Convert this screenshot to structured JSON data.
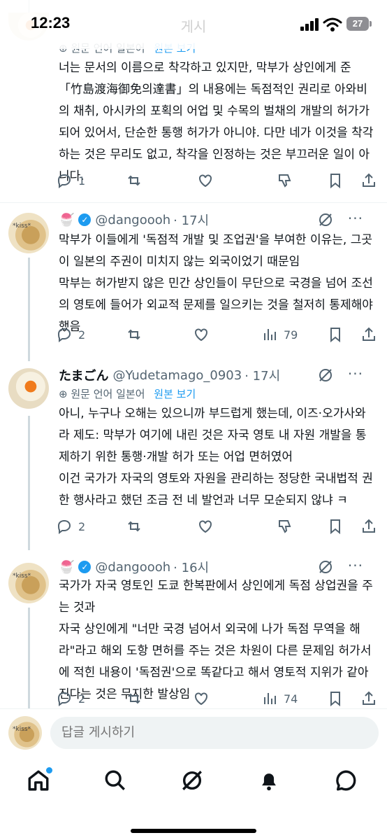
{
  "status_bar": {
    "time": "12:23",
    "title": "게시",
    "battery": "27"
  },
  "tweets": [
    {
      "translate_label": "원문 언어 일본어",
      "translate_link": "원본 보기",
      "body": "너는 문서의 이름으로 착각하고 있지만, 막부가 상인에게 준「竹島渡海御免의達書」의 내용에는 독점적인 권리로 아와비의 채취, 아시카의 포획의 어업 및 수목의 벌채의 개발의 허가가 되어 있어서, 단순한 통행 허가가 아니야. 다만 네가 이것을 착각하는 것은 무리도 없고, 착각을 인정하는 것은 부끄러운 일이 아니다.",
      "replies": "1"
    },
    {
      "emoji": "🍧",
      "handle": "@dangoooh",
      "time": "· 17시",
      "body": "막부가 이들에게 '독점적 개발 및 조업권'을 부여한 이유는, 그곳이 일본의 주권이 미치지 않는 외국이었기 때문임\n막부는 허가받지 않은 민간 상인들이 무단으로 국경을 넘어 조선의 영토에 들어가 외교적 문제를 일으키는 것을 철저히 통제해야 했음",
      "replies": "2",
      "views": "79"
    },
    {
      "display_name": "たまごん",
      "handle": "@Yudetamago_0903",
      "time": "· 17시",
      "translate_label": "원문 언어 일본어",
      "translate_link": "원본 보기",
      "body": "아니, 누구나 오해는 있으니까 부드럽게 했는데, 이즈·오가사와라 제도: 막부가 여기에 내린 것은 자국 영토 내 자원 개발을 통제하기 위한 통행·개발 허가 또는 어업 면허였어\n이건 국가가 자국의 영토와 자원을 관리하는 정당한 국내법적 권한 행사라고 했던 조금 전 네 발언과 너무 모순되지 않냐 ㅋ",
      "replies": "2"
    },
    {
      "emoji": "🍧",
      "handle": "@dangoooh",
      "time": "· 16시",
      "body": "국가가 자국 영토인 도쿄 한복판에서 상인에게 독점 상업권을 주는 것과\n자국 상인에게 \"너만 국경 넘어서 외국에 나가 독점 무역을 해라\"라고 해외 도항 면허를 주는 것은 차원이 다른 문제임 허가서에 적힌 내용이 '독점권'으로 똑같다고 해서 영토적 지위가 같아진다는 것은 무지한 발상임",
      "replies": "2",
      "views": "74"
    }
  ],
  "composer": {
    "placeholder": "답글 게시하기"
  },
  "tabs": [
    "home-icon",
    "search-icon",
    "grok-icon",
    "notifications-icon",
    "messages-icon"
  ]
}
